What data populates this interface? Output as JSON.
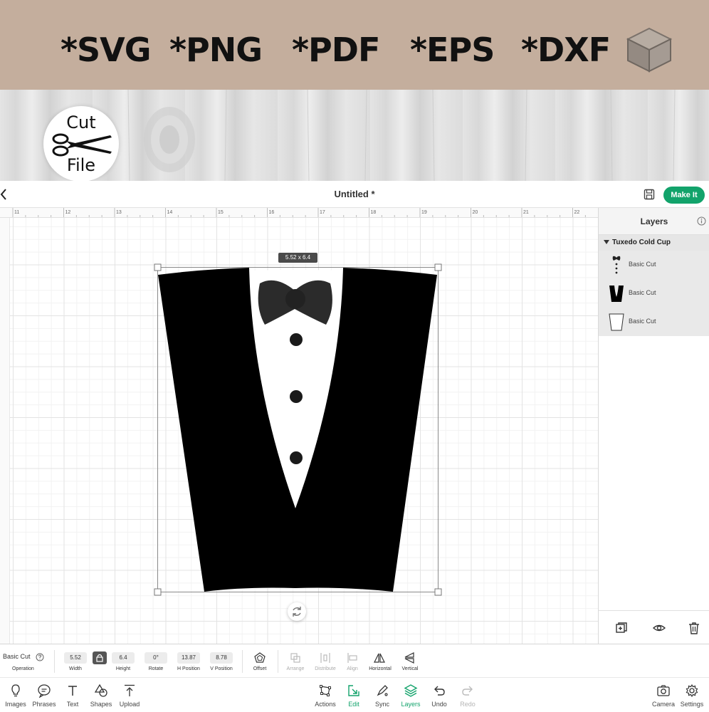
{
  "banner": {
    "formats": [
      "*SVG",
      "*PNG",
      "*PDF",
      "*EPS",
      "*DXF"
    ],
    "cube_icon": "cube-icon"
  },
  "badge": {
    "top_text": "Cut",
    "bottom_text": "File",
    "icon": "scissors-icon"
  },
  "header": {
    "title": "Untitled *",
    "back_icon": "chevron-left-icon",
    "save_icon": "save-icon",
    "make_it_label": "Make It",
    "accent": "#12a36b"
  },
  "ruler": {
    "ticks": [
      "11",
      "12",
      "13",
      "14",
      "15",
      "16",
      "17",
      "18",
      "19",
      "20",
      "21",
      "22"
    ]
  },
  "canvas": {
    "size_badge": "5.52 x 6.4"
  },
  "layers": {
    "title": "Layers",
    "group_name": "Tuxedo Cold Cup",
    "items": [
      {
        "label": "Basic Cut",
        "thumb": "bow-buttons"
      },
      {
        "label": "Basic Cut",
        "thumb": "jacket"
      },
      {
        "label": "Basic Cut",
        "thumb": "cup"
      }
    ]
  },
  "props": {
    "operation_value": "Basic Cut",
    "operation_label": "Operation",
    "width_value": "5.52",
    "width_label": "Width",
    "height_value": "6.4",
    "height_label": "Height",
    "rotate_value": "0°",
    "rotate_label": "Rotate",
    "hpos_value": "13.87",
    "hpos_label": "H Position",
    "vpos_value": "8.78",
    "vpos_label": "V Position",
    "offset_label": "Offset",
    "arrange_label": "Arrange",
    "distribute_label": "Distribute",
    "align_label": "Align",
    "horizontal_label": "Horizontal",
    "vertical_label": "Vertical"
  },
  "toolbar": {
    "images": "Images",
    "phrases": "Phrases",
    "text": "Text",
    "shapes": "Shapes",
    "upload": "Upload",
    "actions": "Actions",
    "edit": "Edit",
    "sync": "Sync",
    "layers": "Layers",
    "undo": "Undo",
    "redo": "Redo",
    "camera": "Camera",
    "settings": "Settings"
  }
}
